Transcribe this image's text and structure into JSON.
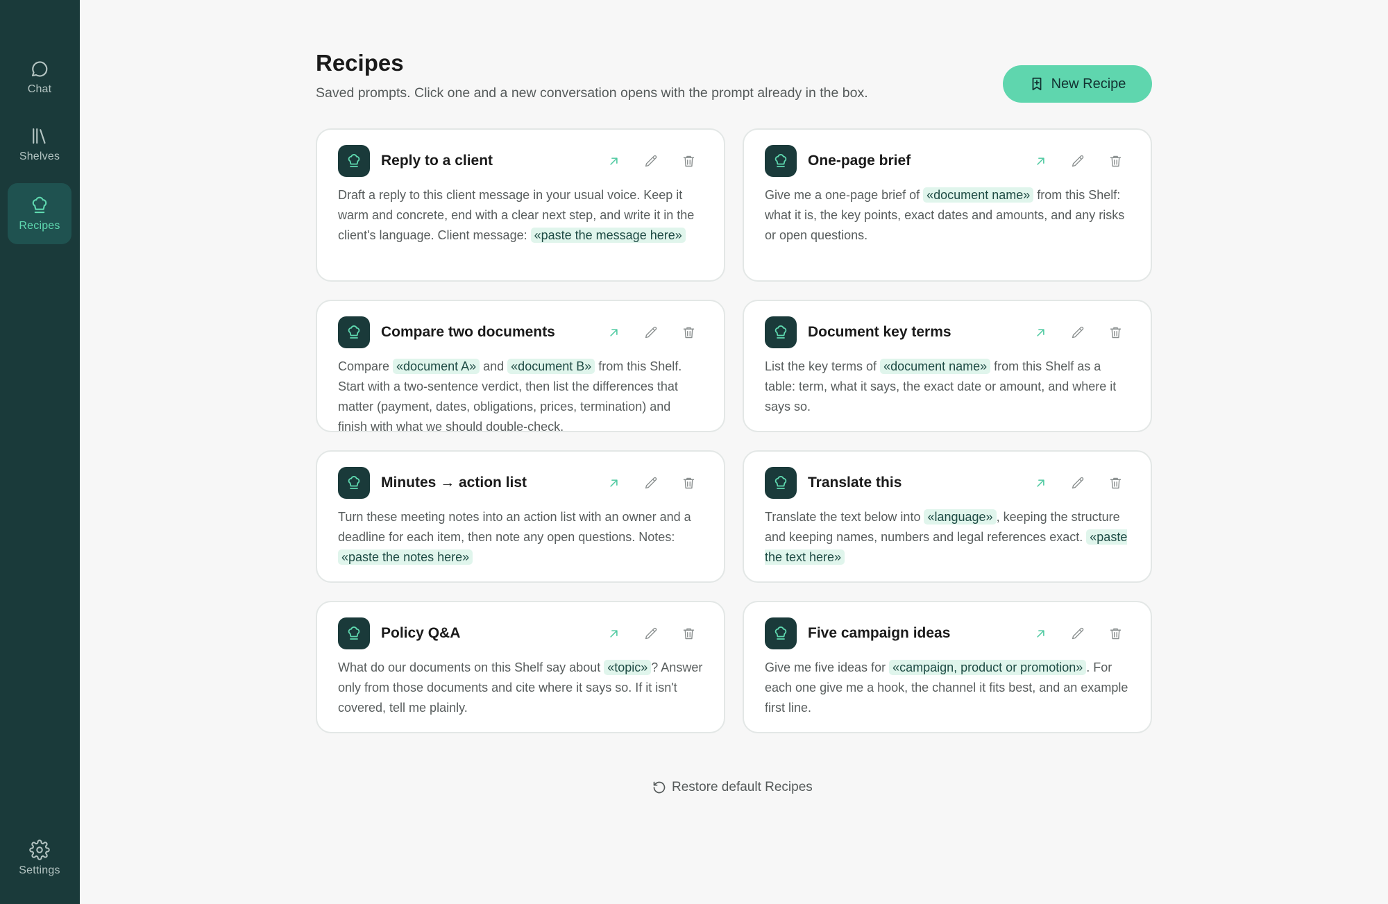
{
  "nav": {
    "chat": "Chat",
    "shelves": "Shelves",
    "recipes": "Recipes",
    "settings": "Settings"
  },
  "header": {
    "title": "Recipes",
    "subtitle": "Saved prompts. Click one and a new conversation opens with the prompt already in the box.",
    "new_button": "New Recipe"
  },
  "recipes": [
    {
      "title": "Reply to a client",
      "body": [
        {
          "t": "Draft a reply to this client message in your usual voice. Keep it warm and concrete, end with a clear next step, and write it in the client's language. Client message: "
        },
        {
          "k": "«paste the message here»"
        }
      ]
    },
    {
      "title": "One-page brief",
      "body": [
        {
          "t": "Give me a one-page brief of "
        },
        {
          "k": "«document name»"
        },
        {
          "t": " from this Shelf: what it is, the key points, exact dates and amounts, and any risks or open questions."
        }
      ]
    },
    {
      "title": "Compare two documents",
      "body": [
        {
          "t": "Compare "
        },
        {
          "k": "«document A»"
        },
        {
          "t": " and "
        },
        {
          "k": "«document B»"
        },
        {
          "t": " from this Shelf. Start with a two-sentence verdict, then list the differences that matter (payment, dates, obligations, prices, termination) and finish with what we should double-check."
        }
      ]
    },
    {
      "title": "Document key terms",
      "body": [
        {
          "t": "List the key terms of "
        },
        {
          "k": "«document name»"
        },
        {
          "t": " from this Shelf as a table: term, what it says, the exact date or amount, and where it says so."
        }
      ]
    },
    {
      "title": "Minutes → action list",
      "body": [
        {
          "t": "Turn these meeting notes into an action list with an owner and a deadline for each item, then note any open questions. Notes: "
        },
        {
          "k": "«paste the notes here»"
        }
      ]
    },
    {
      "title": "Translate this",
      "body": [
        {
          "t": "Translate the text below into "
        },
        {
          "k": "«language»"
        },
        {
          "t": ", keeping the structure and keeping names, numbers and legal references exact. "
        },
        {
          "k": "«paste the text here»"
        }
      ]
    },
    {
      "title": "Policy Q&A",
      "body": [
        {
          "t": "What do our documents on this Shelf say about "
        },
        {
          "k": "«topic»"
        },
        {
          "t": "? Answer only from those documents and cite where it says so. If it isn't covered, tell me plainly."
        }
      ]
    },
    {
      "title": "Five campaign ideas",
      "body": [
        {
          "t": "Give me five ideas for "
        },
        {
          "k": "«campaign, product or promotion»"
        },
        {
          "t": ". For each one give me a hook, the channel it fits best, and an example first line."
        }
      ]
    }
  ],
  "footer": {
    "restore": "Restore default Recipes"
  },
  "colors": {
    "sidebar": "#1a3a3a",
    "accent": "#5fd6ae",
    "token_bg": "#e0f5ec"
  }
}
